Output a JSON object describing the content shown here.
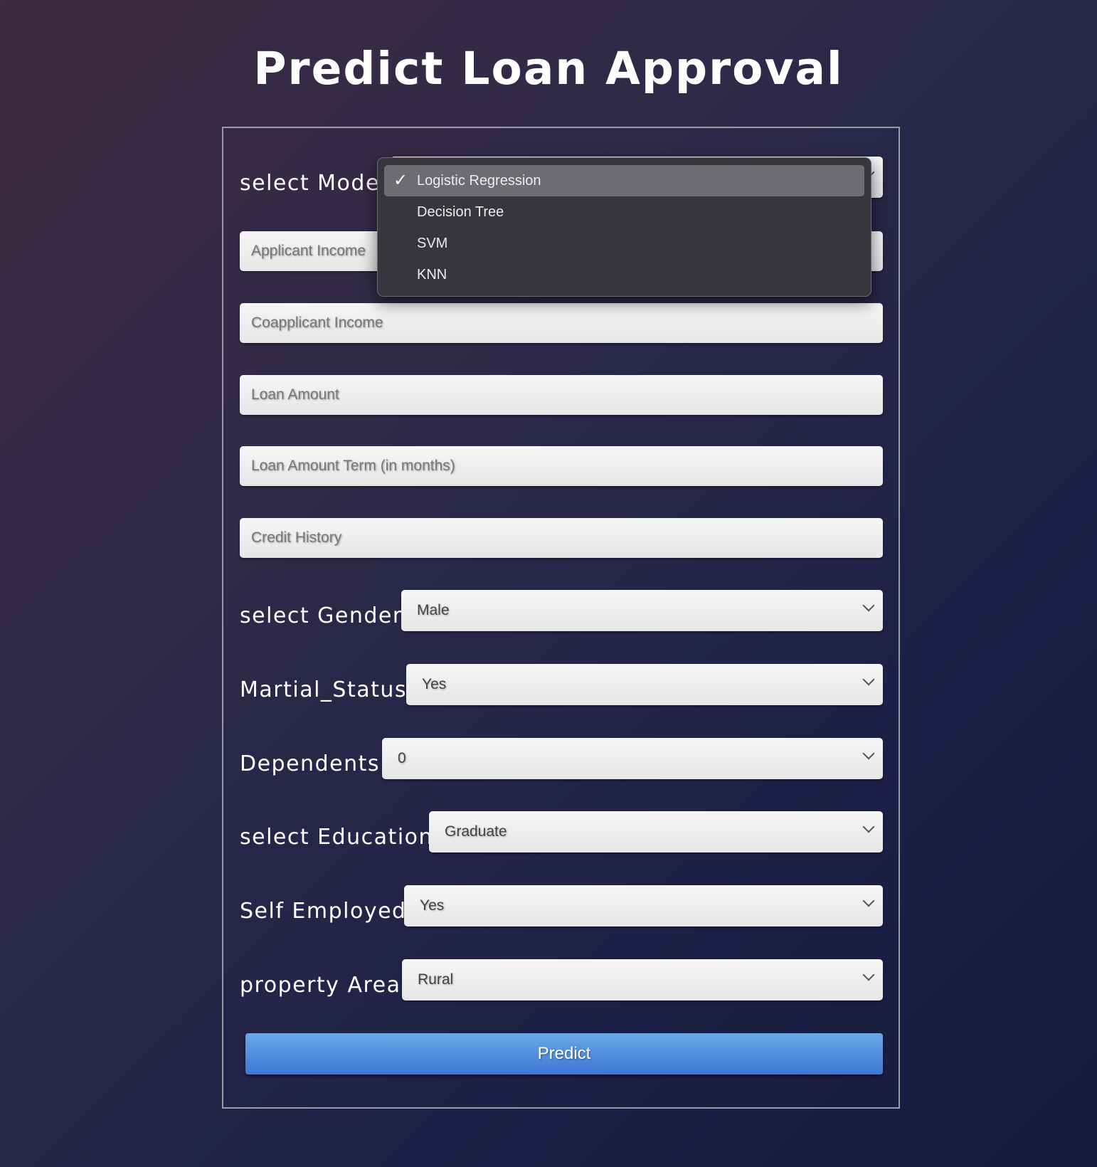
{
  "page": {
    "title": "Predict Loan Approval"
  },
  "form": {
    "model": {
      "label": "select Model",
      "selected": "Logistic Regression",
      "options": [
        "Logistic Regression",
        "Decision Tree",
        "SVM",
        "KNN"
      ]
    },
    "applicant_income": {
      "placeholder": "Applicant Income"
    },
    "coapplicant_income": {
      "placeholder": "Coapplicant Income"
    },
    "loan_amount": {
      "placeholder": "Loan Amount"
    },
    "loan_amount_term": {
      "placeholder": "Loan Amount Term (in months)"
    },
    "credit_history": {
      "placeholder": "Credit History"
    },
    "gender": {
      "label": "select Gender",
      "value": "Male"
    },
    "marital_status": {
      "label": "Martial_Status",
      "value": "Yes"
    },
    "dependents": {
      "label": "Dependents",
      "value": "0"
    },
    "education": {
      "label": "select Education",
      "value": "Graduate"
    },
    "self_employed": {
      "label": "Self Employed",
      "value": "Yes"
    },
    "property_area": {
      "label": "property Area",
      "value": "Rural"
    },
    "predict_label": "Predict"
  },
  "icons": {
    "check": "checkmark-icon",
    "chevron": "chevron-down-icon"
  },
  "colors": {
    "button": "#4a86dc",
    "dropdown_bg": "#36363c",
    "highlight": "#6c6c72"
  }
}
